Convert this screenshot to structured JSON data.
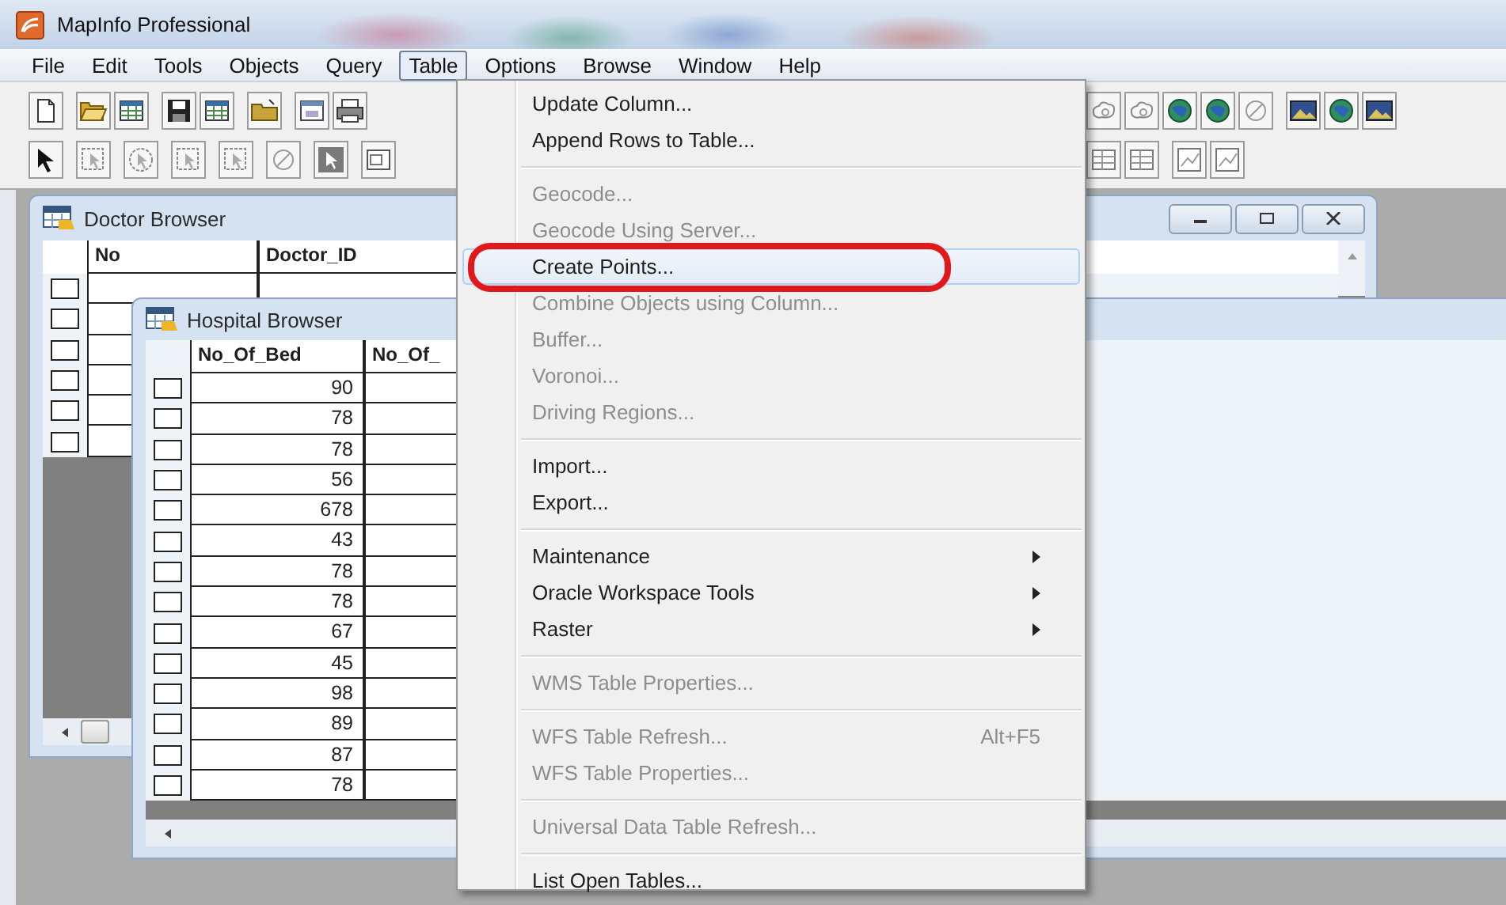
{
  "window": {
    "title": "MapInfo Professional"
  },
  "menu_bar": [
    {
      "label": "File",
      "selected": false
    },
    {
      "label": "Edit",
      "selected": false
    },
    {
      "label": "Tools",
      "selected": false
    },
    {
      "label": "Objects",
      "selected": false
    },
    {
      "label": "Query",
      "selected": false
    },
    {
      "label": "Table",
      "selected": true
    },
    {
      "label": "Options",
      "selected": false
    },
    {
      "label": "Browse",
      "selected": false
    },
    {
      "label": "Window",
      "selected": false
    },
    {
      "label": "Help",
      "selected": false
    }
  ],
  "documents": [
    {
      "title": "Doctor Browser",
      "columns": [
        "No",
        "Doctor_ID"
      ],
      "rows": [
        {
          "selected": false,
          "cells": []
        },
        {
          "selected": false,
          "cells": []
        },
        {
          "selected": false,
          "cells": []
        },
        {
          "selected": false,
          "cells": []
        },
        {
          "selected": false,
          "cells": []
        },
        {
          "selected": false,
          "cells": []
        }
      ]
    },
    {
      "title": "Hospital Browser",
      "columns": [
        "No_Of_Bed",
        "No_Of_"
      ],
      "rows": [
        {
          "selected": false,
          "cells": [
            "90"
          ]
        },
        {
          "selected": false,
          "cells": [
            "78"
          ]
        },
        {
          "selected": false,
          "cells": [
            "78"
          ]
        },
        {
          "selected": false,
          "cells": [
            "56"
          ]
        },
        {
          "selected": false,
          "cells": [
            "678"
          ]
        },
        {
          "selected": false,
          "cells": [
            "43"
          ]
        },
        {
          "selected": false,
          "cells": [
            "78"
          ]
        },
        {
          "selected": false,
          "cells": [
            "78"
          ]
        },
        {
          "selected": false,
          "cells": [
            "67"
          ]
        },
        {
          "selected": false,
          "cells": [
            "45"
          ]
        },
        {
          "selected": false,
          "cells": [
            "98"
          ]
        },
        {
          "selected": false,
          "cells": [
            "89"
          ]
        },
        {
          "selected": false,
          "cells": [
            "87"
          ]
        },
        {
          "selected": false,
          "cells": [
            "78"
          ]
        }
      ]
    }
  ],
  "table_menu": {
    "items": [
      {
        "kind": "item",
        "label": "Update Column...",
        "selected": false,
        "disabled": false,
        "submenu": false,
        "circled": false
      },
      {
        "kind": "item",
        "label": "Append Rows to Table...",
        "selected": false,
        "disabled": false,
        "submenu": false,
        "circled": false
      },
      {
        "kind": "separator"
      },
      {
        "kind": "item",
        "label": "Geocode...",
        "selected": false,
        "disabled": true,
        "submenu": false,
        "circled": false
      },
      {
        "kind": "item",
        "label": "Geocode Using Server...",
        "selected": false,
        "disabled": true,
        "submenu": false,
        "circled": false
      },
      {
        "kind": "item",
        "label": "Create Points...",
        "selected": true,
        "disabled": false,
        "submenu": false,
        "circled": true
      },
      {
        "kind": "item",
        "label": "Combine Objects using Column...",
        "selected": false,
        "disabled": true,
        "submenu": false,
        "circled": false
      },
      {
        "kind": "item",
        "label": "Buffer...",
        "selected": false,
        "disabled": true,
        "submenu": false,
        "circled": false
      },
      {
        "kind": "item",
        "label": "Voronoi...",
        "selected": false,
        "disabled": true,
        "submenu": false,
        "circled": false
      },
      {
        "kind": "item",
        "label": "Driving Regions...",
        "selected": false,
        "disabled": true,
        "submenu": false,
        "circled": false
      },
      {
        "kind": "separator"
      },
      {
        "kind": "item",
        "label": "Import...",
        "selected": false,
        "disabled": false,
        "submenu": false,
        "circled": false
      },
      {
        "kind": "item",
        "label": "Export...",
        "selected": false,
        "disabled": false,
        "submenu": false,
        "circled": false
      },
      {
        "kind": "separator"
      },
      {
        "kind": "item",
        "label": "Maintenance",
        "selected": false,
        "disabled": false,
        "submenu": true,
        "circled": false
      },
      {
        "kind": "item",
        "label": "Oracle Workspace Tools",
        "selected": false,
        "disabled": false,
        "submenu": true,
        "circled": false
      },
      {
        "kind": "item",
        "label": "Raster",
        "selected": false,
        "disabled": false,
        "submenu": true,
        "circled": false
      },
      {
        "kind": "separator"
      },
      {
        "kind": "item",
        "label": "WMS Table Properties...",
        "selected": false,
        "disabled": true,
        "submenu": false,
        "circled": false
      },
      {
        "kind": "separator"
      },
      {
        "kind": "item",
        "label": "WFS Table Refresh...",
        "shortcut": "Alt+F5",
        "selected": false,
        "disabled": true,
        "submenu": false,
        "circled": false
      },
      {
        "kind": "item",
        "label": "WFS Table Properties...",
        "selected": false,
        "disabled": true,
        "submenu": false,
        "circled": false
      },
      {
        "kind": "separator"
      },
      {
        "kind": "item",
        "label": "Universal Data Table Refresh...",
        "selected": false,
        "disabled": true,
        "submenu": false,
        "circled": false
      },
      {
        "kind": "separator"
      },
      {
        "kind": "item",
        "label": "List Open Tables...",
        "selected": false,
        "disabled": false,
        "submenu": false,
        "circled": false
      }
    ]
  }
}
